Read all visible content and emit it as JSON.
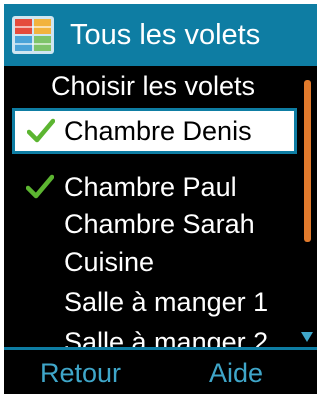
{
  "title_bar": {
    "icon": "shutter-app-icon",
    "title": "Tous les volets"
  },
  "subheader": "Choisir les volets",
  "list": {
    "items": [
      {
        "label": "Chambre Denis",
        "checked": true,
        "selected": true
      },
      {
        "label": "Chambre Paul",
        "checked": true,
        "selected": false
      },
      {
        "label": "Chambre Sarah",
        "checked": false,
        "selected": false
      },
      {
        "label": "Cuisine",
        "checked": false,
        "selected": false
      },
      {
        "label": "Salle à manger 1",
        "checked": false,
        "selected": false
      },
      {
        "label": "Salle à manger 2",
        "checked": false,
        "selected": false
      }
    ]
  },
  "softkeys": {
    "left": "Retour",
    "right": "Aide"
  },
  "colors": {
    "accent": "#0e7da3",
    "softkey_text": "#3fa6c9",
    "scroll_thumb": "#e17a2c",
    "check": "#5cb531"
  }
}
